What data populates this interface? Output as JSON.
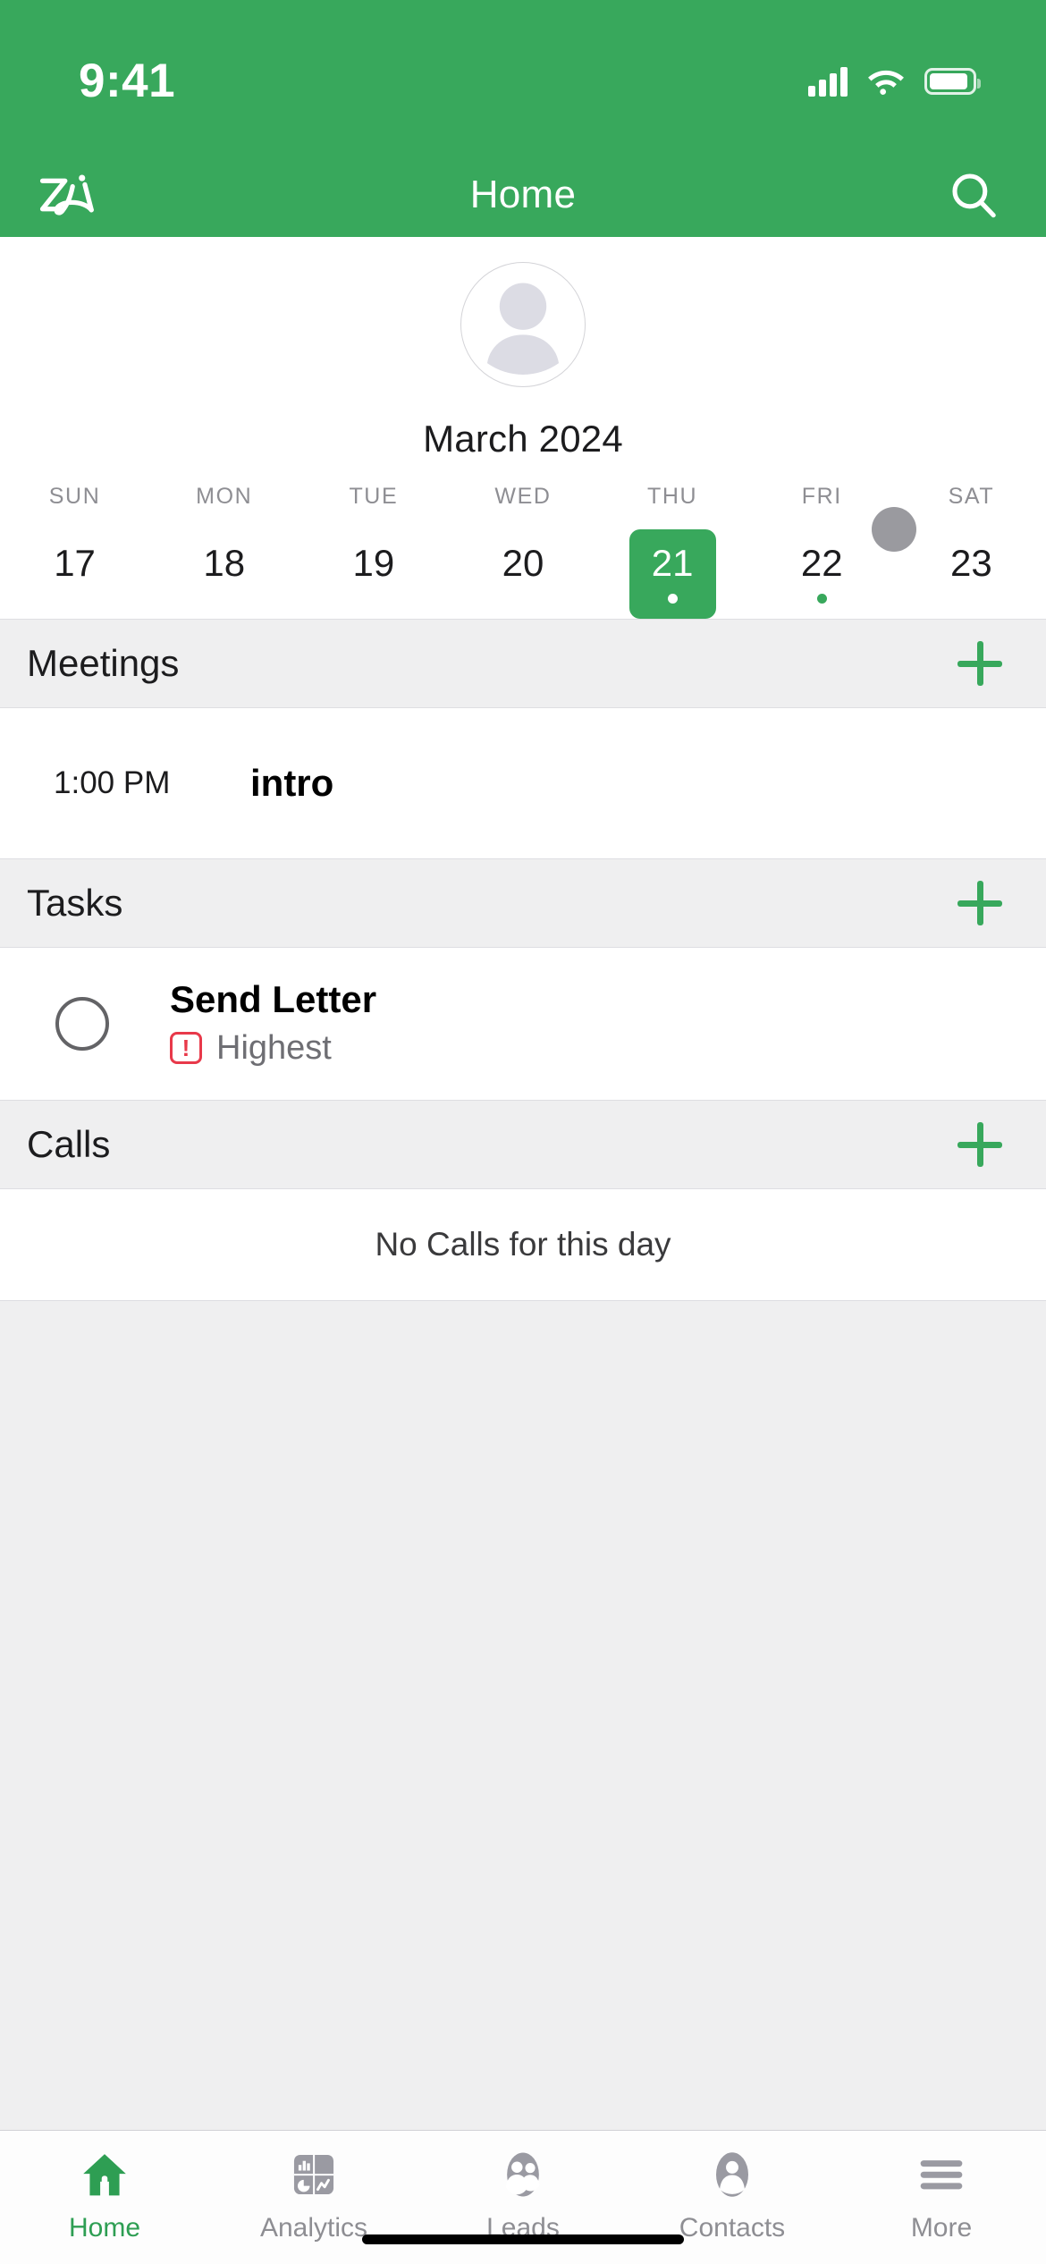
{
  "status_bar": {
    "time": "9:41",
    "signal_icon": "cellular-signal-icon",
    "wifi_icon": "wifi-icon",
    "battery_icon": "battery-icon"
  },
  "nav_bar": {
    "logo_name": "zia-logo",
    "title": "Home",
    "search_icon": "search-icon"
  },
  "profile": {
    "avatar_name": "user-avatar-placeholder"
  },
  "calendar": {
    "month_label": "March 2024",
    "scroll_knob_color": "#9a9a9f",
    "accent_color": "#38a85c",
    "days": [
      {
        "dow": "SUN",
        "date": "17",
        "selected": false,
        "has_event": false
      },
      {
        "dow": "MON",
        "date": "18",
        "selected": false,
        "has_event": false
      },
      {
        "dow": "TUE",
        "date": "19",
        "selected": false,
        "has_event": false
      },
      {
        "dow": "WED",
        "date": "20",
        "selected": false,
        "has_event": false
      },
      {
        "dow": "THU",
        "date": "21",
        "selected": true,
        "has_event": true
      },
      {
        "dow": "FRI",
        "date": "22",
        "selected": false,
        "has_event": true
      },
      {
        "dow": "SAT",
        "date": "23",
        "selected": false,
        "has_event": false
      }
    ]
  },
  "sections": {
    "meetings": {
      "title": "Meetings",
      "add_icon": "plus-icon",
      "items": [
        {
          "time": "1:00 PM",
          "title": "intro"
        }
      ]
    },
    "tasks": {
      "title": "Tasks",
      "add_icon": "plus-icon",
      "items": [
        {
          "name": "Send Letter",
          "priority": "Highest",
          "priority_icon": "exclamation-priority-icon",
          "priority_color": "#e8394a",
          "checked": false
        }
      ]
    },
    "calls": {
      "title": "Calls",
      "add_icon": "plus-icon",
      "empty_text": "No Calls for this day"
    }
  },
  "tab_bar": {
    "active_color": "#2e9e53",
    "inactive_color": "#8e8e93",
    "tabs": [
      {
        "label": "Home",
        "icon": "home-icon",
        "active": true
      },
      {
        "label": "Analytics",
        "icon": "analytics-icon",
        "active": false
      },
      {
        "label": "Leads",
        "icon": "leads-icon",
        "active": false
      },
      {
        "label": "Contacts",
        "icon": "contacts-icon",
        "active": false
      },
      {
        "label": "More",
        "icon": "hamburger-menu-icon",
        "active": false
      }
    ]
  }
}
